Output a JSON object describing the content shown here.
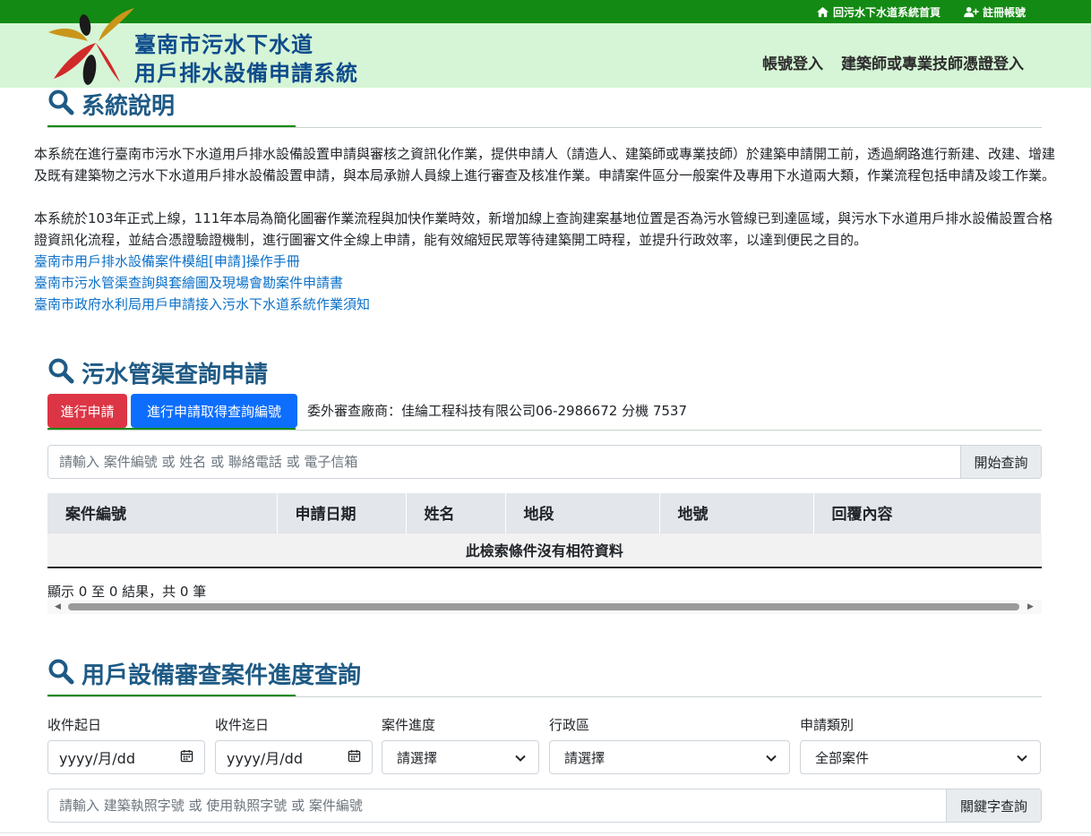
{
  "topbar": {
    "home_link": "回污水下水道系統首頁",
    "register_link": "註冊帳號"
  },
  "header": {
    "title_line1": "臺南市污水下水道",
    "title_line2": "用戶排水設備申請系統",
    "nav_login": "帳號登入",
    "nav_cert_login": "建築師或專業技師憑證登入"
  },
  "section1": {
    "heading": "系統說明",
    "paragraph1": "本系統在進行臺南市污水下水道用戶排水設備設置申請與審核之資訊化作業，提供申請人（請造人、建築師或專業技師）於建築申請開工前，透過網路進行新建、改建、增建及既有建築物之污水下水道用戶排水設備設置申請，與本局承辦人員線上進行審查及核准作業。申請案件區分一般案件及專用下水道兩大類，作業流程包括申請及竣工作業。",
    "paragraph2": "本系統於103年正式上線，111年本局為簡化圖審作業流程與加快作業時效，新增加線上查詢建案基地位置是否為污水管線已到達區域，與污水下水道用戶排水設備設置合格證資訊化流程，並結合憑證驗證機制，進行圖審文件全線上申請，能有效縮短民眾等待建築開工時程，並提升行政效率，以達到便民之目的。",
    "links": [
      "臺南市用戶排水設備案件模組[申請]操作手冊",
      "臺南市污水管渠查詢與套繪圖及現場會勘案件申請書",
      "臺南市政府水利局用戶申請接入污水下水道系統作業須知"
    ]
  },
  "section2": {
    "heading": "污水管渠查詢申請",
    "btn_apply": "進行申請",
    "btn_apply_get_no": "進行申請取得查詢編號",
    "vendor_text": "委外審查廠商：佳綸工程科技有限公司06-2986672 分機 7537",
    "search_placeholder": "請輸入 案件編號 或 姓名 或 聯絡電話 或 電子信箱",
    "search_button": "開始查詢",
    "table": {
      "headers": [
        "案件編號",
        "申請日期",
        "姓名",
        "地段",
        "地號",
        "回覆內容"
      ],
      "empty_message": "此檢索條件沒有相符資料"
    },
    "table_info": "顯示 0 至 0 結果，共 0 筆"
  },
  "section3": {
    "heading": "用戶設備審查案件進度查詢",
    "labels": {
      "date_from": "收件起日",
      "date_to": "收件迄日",
      "progress": "案件進度",
      "district": "行政區",
      "type": "申請類別"
    },
    "date_placeholder": "yyyy/月/dd",
    "progress_selected": "請選擇",
    "district_selected": "請選擇",
    "type_selected": "全部案件",
    "keyword_placeholder": "請輸入 建築執照字號 或 使用執照字號 或 案件編號",
    "keyword_button": "關鍵字查詢"
  },
  "colors": {
    "topbar": "#138a13",
    "header_bg": "#d6f5d6",
    "heading_blue": "#1e5a85",
    "link_blue": "#0b70c8",
    "btn_red": "#dc3545",
    "btn_blue": "#0d6efd"
  },
  "icons": [
    "home-icon",
    "user-plus-icon",
    "search-icon",
    "calendar-icon",
    "chevron-down-icon"
  ]
}
